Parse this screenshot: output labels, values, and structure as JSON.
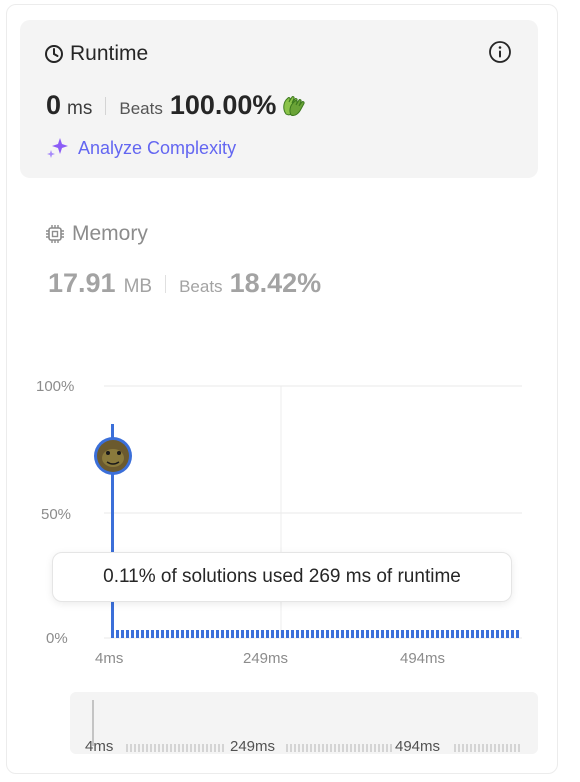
{
  "runtime": {
    "title": "Runtime",
    "value": "0",
    "unit": "ms",
    "beats_label": "Beats",
    "beats_value": "100.00%",
    "analyze_label": "Analyze Complexity"
  },
  "memory": {
    "title": "Memory",
    "value": "17.91",
    "unit": "MB",
    "beats_label": "Beats",
    "beats_value": "18.42%"
  },
  "tooltip": "0.11% of solutions used 269 ms of runtime",
  "chart_data": {
    "type": "bar",
    "title": "",
    "xlabel": "",
    "ylabel": "",
    "yticks": [
      "100%",
      "50%",
      "0%"
    ],
    "xticks": [
      "4ms",
      "249ms",
      "494ms"
    ],
    "ylim": [
      0,
      100
    ],
    "grid": true,
    "marker": {
      "x_ms": 4,
      "y_percent": 73
    },
    "tall_bar": {
      "x_ms": 4,
      "y_percent": 84
    },
    "accent_color": "#3b6fd9"
  },
  "mini_chart": {
    "xticks": [
      "4ms",
      "249ms",
      "494ms"
    ]
  },
  "colors": {
    "accent": "#3b6fd9",
    "analyze": "#6366f1",
    "card_bg": "#f4f4f4"
  }
}
